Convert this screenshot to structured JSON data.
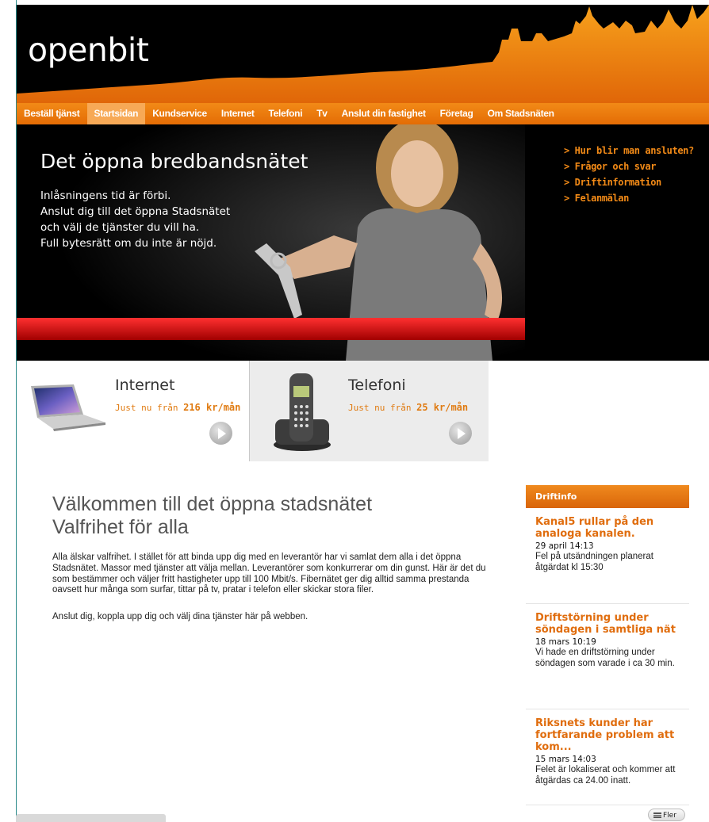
{
  "header": {
    "logo_text": "openbit"
  },
  "nav": {
    "items": [
      {
        "label": "Beställ tjänst",
        "active": false
      },
      {
        "label": "Startsidan",
        "active": true
      },
      {
        "label": "Kundservice",
        "active": false
      },
      {
        "label": "Internet",
        "active": false
      },
      {
        "label": "Telefoni",
        "active": false
      },
      {
        "label": "Tv",
        "active": false
      },
      {
        "label": "Anslut din fastighet",
        "active": false
      },
      {
        "label": "Företag",
        "active": false
      },
      {
        "label": "Om Stadsnäten",
        "active": false
      }
    ]
  },
  "hero": {
    "title": "Det öppna bredbandsnätet",
    "lines": [
      "Inlåsningens tid är förbi.",
      "Anslut dig till det öppna Stadsnätet",
      "och välj de tjänster du vill ha.",
      "Full bytesrätt om du inte är nöjd."
    ],
    "links": [
      "> Hur blir man ansluten?",
      "> Frågor och svar",
      "> Driftinformation",
      "> Felanmälan"
    ]
  },
  "promos": {
    "internet": {
      "title": "Internet",
      "price_prefix": "Just nu från",
      "price": "216 kr/mån"
    },
    "telefoni": {
      "title": "Telefoni",
      "price_prefix": "Just nu från",
      "price": "25 kr/mån"
    }
  },
  "main": {
    "heading_line1": "Välkommen till det öppna stadsnätet",
    "heading_line2": "Valfrihet för alla",
    "paragraph1": "Alla älskar valfrihet. I stället för att binda upp dig med en leverantör har vi samlat dem alla i det öppna Stadsnätet. Massor med tjänster att välja mellan. Leverantörer som konkurrerar om din gunst. Här är det du som bestämmer och väljer fritt hastigheter upp till 100 Mbit/s. Fibernätet ger dig alltid samma prestanda oavsett hur många som surfar, tittar på tv, pratar i telefon eller skickar stora filer.",
    "paragraph2": "Anslut dig, koppla upp dig och välj dina tjänster här på webben."
  },
  "sidebar": {
    "heading": "Driftinfo",
    "news": [
      {
        "title": "Kanal5 rullar på den analoga kanalen.",
        "date": "29 april 14:13",
        "text": "Fel på utsändningen planerat åtgärdat kl 15:30"
      },
      {
        "title": "Driftstörning under söndagen i samtliga nät",
        "date": "18 mars 10:19",
        "text": "Vi hade en driftstörning under söndagen som varade i ca 30 min."
      },
      {
        "title": "Riksnets kunder har fortfarande problem att kom...",
        "date": "15 mars 14:03",
        "text": "Felet är lokaliserat och kommer att åtgärdas ca 24.00 inatt."
      }
    ],
    "more_label": "Fler"
  },
  "colors": {
    "accent": "#f28a17",
    "nav_active": "#f7a956",
    "header_bg": "#000000"
  }
}
